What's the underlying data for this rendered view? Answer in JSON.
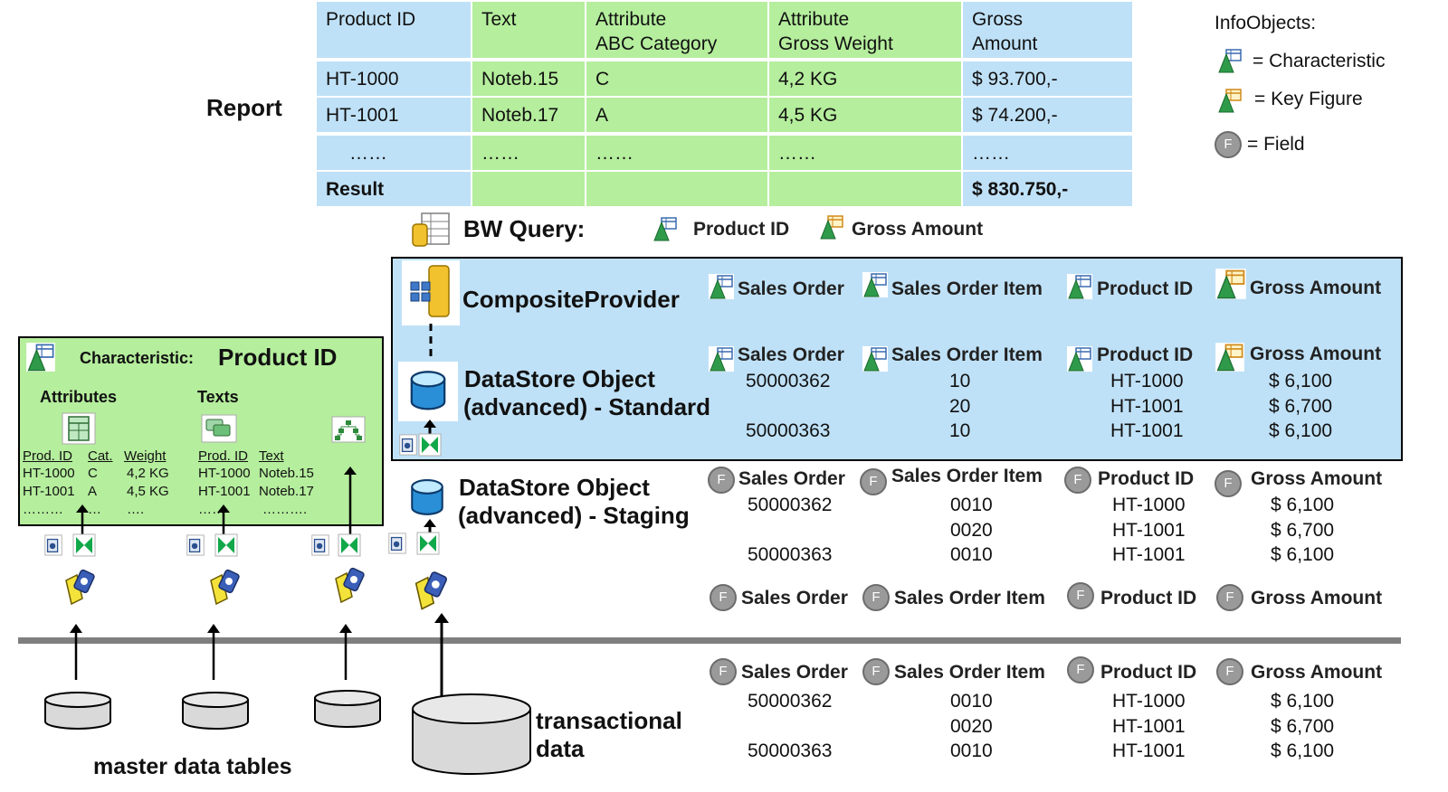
{
  "report": {
    "label": "Report",
    "headers": [
      "Product ID",
      "Text",
      "Attribute\nABC Category",
      "Attribute\nGross Weight",
      "Gross\nAmount"
    ],
    "rows": [
      [
        "HT-1000",
        "Noteb.15",
        "C",
        "4,2 KG",
        "$ 93.700,-"
      ],
      [
        "HT-1001",
        "Noteb.17",
        "A",
        "4,5 KG",
        "$ 74.200,-"
      ],
      [
        "……",
        "……",
        "……",
        "……",
        "……"
      ]
    ],
    "result_label": "Result",
    "result_value": "$ 830.750,-"
  },
  "legend": {
    "title": "InfoObjects:",
    "characteristic": "= Characteristic",
    "key_figure": "= Key Figure",
    "field": "= Field",
    "field_letter": "F"
  },
  "query": {
    "label": "BW Query:",
    "fields": [
      "Product ID",
      "Gross Amount"
    ]
  },
  "composite": {
    "label": "CompositeProvider",
    "fields": [
      "Sales Order",
      "Sales Order Item",
      "Product ID",
      "Gross Amount"
    ]
  },
  "dso_standard": {
    "label_line1": "DataStore Object",
    "label_line2": "(advanced) - Standard",
    "fields": [
      "Sales Order",
      "Sales Order Item",
      "Product ID",
      "Gross Amount"
    ],
    "rows": [
      [
        "50000362",
        "10",
        "HT-1000",
        "$ 6,100"
      ],
      [
        "",
        "20",
        "HT-1001",
        "$ 6,700"
      ],
      [
        "50000363",
        "10",
        "HT-1001",
        "$ 6,100"
      ]
    ]
  },
  "dso_staging": {
    "label_line1": "DataStore Object",
    "label_line2": "(advanced) - Staging",
    "fields": [
      "Sales Order",
      "Sales Order Item",
      "Product ID",
      "Gross Amount"
    ],
    "rows": [
      [
        "50000362",
        "0010",
        "HT-1000",
        "$ 6,100"
      ],
      [
        "",
        "0020",
        "HT-1001",
        "$ 6,700"
      ],
      [
        "50000363",
        "0010",
        "HT-1001",
        "$ 6,100"
      ]
    ]
  },
  "source_fields": {
    "fields": [
      "Sales Order",
      "Sales Order Item",
      "Product ID",
      "Gross Amount"
    ]
  },
  "transactional": {
    "label_line1": "transactional",
    "label_line2": "data",
    "fields": [
      "Sales Order",
      "Sales Order Item",
      "Product ID",
      "Gross Amount"
    ],
    "rows": [
      [
        "50000362",
        "0010",
        "HT-1000",
        "$ 6,100"
      ],
      [
        "",
        "0020",
        "HT-1001",
        "$ 6,700"
      ],
      [
        "50000363",
        "0010",
        "HT-1001",
        "$ 6,100"
      ]
    ]
  },
  "characteristic": {
    "prefix": "Characteristic:",
    "name": "Product ID",
    "attributes_label": "Attributes",
    "texts_label": "Texts",
    "attr_headers": [
      "Prod. ID",
      "Cat.",
      "Weight"
    ],
    "attr_rows": [
      [
        "HT-1000",
        "C",
        "4,2 KG"
      ],
      [
        "HT-1001",
        "A",
        "4,5 KG"
      ],
      [
        "………",
        "…",
        "…."
      ]
    ],
    "text_headers": [
      "Prod. ID",
      "Text"
    ],
    "text_rows": [
      [
        "HT-1000",
        "Noteb.15"
      ],
      [
        "HT-1001",
        "Noteb.17"
      ],
      [
        "……",
        "………."
      ]
    ]
  },
  "master": {
    "label": "master data tables"
  },
  "colors": {
    "blue": "#bfe1f7",
    "green": "#b5ee9d",
    "field_grey": "#9a9a9a",
    "line_grey": "#7f7f7f"
  }
}
